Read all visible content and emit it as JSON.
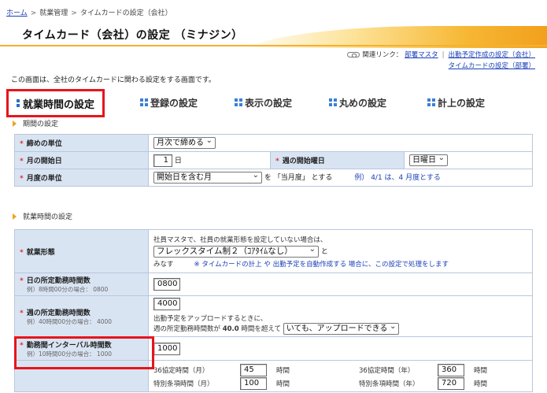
{
  "breadcrumb": {
    "home": "ホーム",
    "sep": ">",
    "section": "就業管理",
    "current": "タイムカードの設定（会社）"
  },
  "page_title": "タイムカード（会社）の設定 （ミナジン）",
  "related_links": {
    "label": "関連リンク：",
    "link1": "部署マスタ",
    "sep": "|",
    "link2": "出勤予定作成の設定（会社）",
    "link3": "タイムカードの設定（部署）"
  },
  "intro": "この画面は、全社のタイムカードに関わる設定をする画面です。",
  "tabs": [
    {
      "label": "就業時間の設定"
    },
    {
      "label": "登録の設定"
    },
    {
      "label": "表示の設定"
    },
    {
      "label": "丸めの設定"
    },
    {
      "label": "計上の設定"
    }
  ],
  "period_section": {
    "heading": "期間の設定",
    "closing_unit": {
      "label": "締めの単位",
      "value": "月次で締める"
    },
    "month_start": {
      "label": "月の開始日",
      "value": "1",
      "unit": "日",
      "week_label": "週の開始曜日",
      "week_value": "日曜日"
    },
    "month_unit": {
      "label": "月度の単位",
      "value": "開始日を含む月",
      "text1": "を 「当月度」 とする",
      "example": "例） 4/1 は、4 月度とする"
    }
  },
  "worktime_section": {
    "heading": "就業時間の設定",
    "work_form": {
      "label": "就業形態",
      "note1": "社員マスタで、社員の就業形態を設定していない場合は、",
      "value": "フレックスタイム制２（ｺｱﾀｲﾑなし）",
      "to": "と",
      "minasu": "みなす",
      "note2": "※ タイムカードの計上 や 出勤予定を自動作成する 場合に、この設定で処理をします"
    },
    "daily_hours": {
      "label": "日の所定勤務時間数",
      "sub": "例）8時間00分の場合： 0800",
      "value": "0800"
    },
    "weekly_hours": {
      "label": "週の所定勤務時間数",
      "sub": "例）40時間00分の場合： 4000",
      "value": "4000",
      "note1": "出勤予定をアップロードするときに、",
      "note2_a": "週の所定勤務時間数が",
      "note2_b": "40.0",
      "note2_c": "時間を超えて",
      "select": "いても、アップロードできる"
    },
    "interval": {
      "label": "勤務間インターバル時間数",
      "sub": "例）10時間00分の場合： 1000",
      "value": "1000"
    },
    "agreement": {
      "m_label": "36協定時間（月）",
      "m_value": "45",
      "unit": "時間",
      "y_label": "36協定時間（年）",
      "y_value": "360",
      "sm_label": "特別条項時間（月）",
      "sm_value": "100",
      "sy_label": "特別条項時間（年）",
      "sy_value": "720"
    }
  }
}
